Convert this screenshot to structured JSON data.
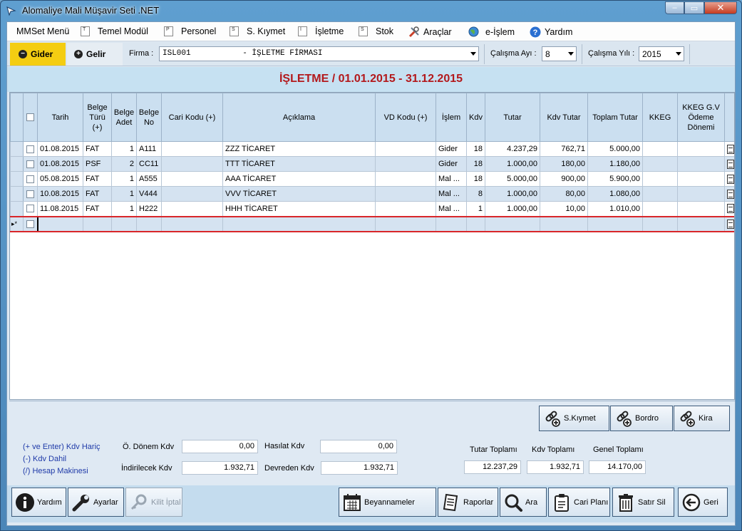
{
  "window": {
    "title": "Alomaliye Mali Müşavir Seti .NET",
    "min": "–",
    "max": "▭",
    "close": "✕"
  },
  "menu": [
    {
      "label": "MMSet Menü",
      "icon": ""
    },
    {
      "label": "Temel Modül",
      "icon": "T"
    },
    {
      "label": "Personel",
      "icon": "P"
    },
    {
      "label": "S. Kıymet",
      "icon": "S"
    },
    {
      "label": "İşletme",
      "icon": "I"
    },
    {
      "label": "Stok",
      "icon": "S"
    },
    {
      "label": "Araçlar",
      "icon": "tools-icon"
    },
    {
      "label": "e-İşlem",
      "icon": "globe-icon"
    },
    {
      "label": "Yardım",
      "icon": "help-icon"
    }
  ],
  "toolbar": {
    "gider": "Gider",
    "gelir": "Gelir",
    "firma_label": "Firma :",
    "firma_value": "ISL001           - İŞLETME FİRMASI",
    "ay_label": "Çalışma Ayı :",
    "ay_value": "8",
    "yil_label": "Çalışma Yılı :",
    "yil_value": "2015"
  },
  "heading": "İŞLETME / 01.01.2015 - 31.12.2015",
  "grid": {
    "columns": [
      "",
      "",
      "Tarih",
      "Belge Türü (+)",
      "Belge Adet",
      "Belge No",
      "Cari Kodu (+)",
      "Açıklama",
      "VD Kodu (+)",
      "İşlem",
      "Kdv",
      "Tutar",
      "Kdv Tutar",
      "Toplam Tutar",
      "KKEG",
      "KKEG G.V Ödeme Dönemi",
      ""
    ],
    "rows": [
      [
        "01.08.2015",
        "FAT",
        "1",
        "A111",
        "",
        "ZZZ TİCARET",
        "",
        "Gider",
        "18",
        "4.237,29",
        "762,71",
        "5.000,00",
        "",
        ""
      ],
      [
        "01.08.2015",
        "PSF",
        "2",
        "CC11",
        "",
        "TTT TİCARET",
        "",
        "Gider",
        "18",
        "1.000,00",
        "180,00",
        "1.180,00",
        "",
        ""
      ],
      [
        "05.08.2015",
        "FAT",
        "1",
        "A555",
        "",
        "AAA TİCARET",
        "",
        "Mal ...",
        "18",
        "5.000,00",
        "900,00",
        "5.900,00",
        "",
        ""
      ],
      [
        "10.08.2015",
        "FAT",
        "1",
        "V444",
        "",
        "VVV TİCARET",
        "",
        "Mal ...",
        "8",
        "1.000,00",
        "80,00",
        "1.080,00",
        "",
        ""
      ],
      [
        "11.08.2015",
        "FAT",
        "1",
        "H222",
        "",
        "HHH TİCARET",
        "",
        "Mal ...",
        "1",
        "1.000,00",
        "10,00",
        "1.010,00",
        "",
        ""
      ]
    ],
    "new_row_marker": "▸*"
  },
  "side_buttons": {
    "skiymet": "S.Kıymet",
    "bordro": "Bordro",
    "kira": "Kira"
  },
  "hints": [
    "(+ ve Enter) Kdv Hariç",
    "(-)  Kdv Dahil",
    "(/) Hesap Makinesi"
  ],
  "fields": {
    "onceki_donem_label": "Ö. Dönem Kdv",
    "onceki_donem": "0,00",
    "indirilecek_label": "İndirilecek Kdv",
    "indirilecek": "1.932,71",
    "hasilat_label": "Hasılat Kdv",
    "hasilat": "0,00",
    "devreden_label": "Devreden Kdv",
    "devreden": "1.932,71",
    "tutar_toplami_label": "Tutar Toplamı",
    "tutar_toplami": "12.237,29",
    "kdv_toplami_label": "Kdv Toplamı",
    "kdv_toplami": "1.932,71",
    "genel_toplami_label": "Genel Toplamı",
    "genel_toplami": "14.170,00"
  },
  "buttons": {
    "yardim": "Yardım",
    "ayarlar": "Ayarlar",
    "kilit": "Kilit İptal",
    "beyannameler": "Beyannameler",
    "raporlar": "Raporlar",
    "ara": "Ara",
    "cari": "Cari Planı",
    "satir_sil": "Satır Sil",
    "geri": "Geri"
  }
}
